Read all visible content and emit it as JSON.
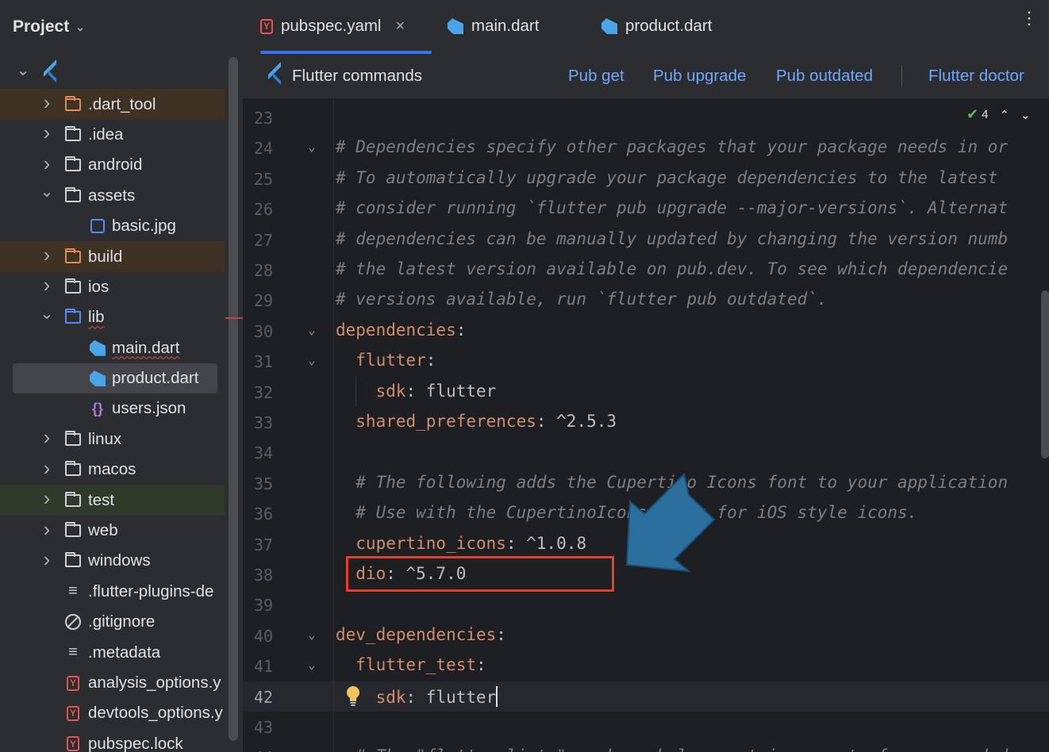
{
  "sidebar": {
    "title": "Project",
    "items": [
      {
        "label": "",
        "kind": "root",
        "arrow": "open",
        "icon": "flutter-icon"
      },
      {
        "label": ".dart_tool",
        "arrow": "closed",
        "icon": "folder-orange-icon",
        "hl": "excl"
      },
      {
        "label": ".idea",
        "arrow": "closed",
        "icon": "folder-settings-icon"
      },
      {
        "label": "android",
        "arrow": "closed",
        "icon": "folder-icon"
      },
      {
        "label": "assets",
        "arrow": "open",
        "icon": "folder-icon"
      },
      {
        "label": "basic.jpg",
        "icon": "image-file-icon",
        "depth": 2
      },
      {
        "label": "build",
        "arrow": "closed",
        "icon": "folder-orange-icon",
        "hl": "excl"
      },
      {
        "label": "ios",
        "arrow": "closed",
        "icon": "folder-icon"
      },
      {
        "label": "lib",
        "arrow": "open",
        "icon": "folder-blue-icon",
        "squiggle": true
      },
      {
        "label": "main.dart",
        "icon": "dart-file-icon",
        "depth": 2,
        "squiggle": true
      },
      {
        "label": "product.dart",
        "icon": "dart-file-icon",
        "depth": 2,
        "selected": true
      },
      {
        "label": "users.json",
        "icon": "json-file-icon",
        "depth": 2
      },
      {
        "label": "linux",
        "arrow": "closed",
        "icon": "folder-icon"
      },
      {
        "label": "macos",
        "arrow": "closed",
        "icon": "folder-icon"
      },
      {
        "label": "test",
        "arrow": "closed",
        "icon": "folder-test-icon",
        "hl": "test"
      },
      {
        "label": "web",
        "arrow": "closed",
        "icon": "folder-web-icon"
      },
      {
        "label": "windows",
        "arrow": "closed",
        "icon": "folder-icon"
      },
      {
        "label": ".flutter-plugins-de",
        "icon": "text-file-icon"
      },
      {
        "label": ".gitignore",
        "icon": "ignore-file-icon"
      },
      {
        "label": ".metadata",
        "icon": "text-file-icon"
      },
      {
        "label": "analysis_options.y",
        "icon": "yaml-file-icon"
      },
      {
        "label": "devtools_options.y",
        "icon": "yaml-file-icon"
      },
      {
        "label": "pubspec.lock",
        "icon": "yaml-file-icon"
      }
    ]
  },
  "tabs": [
    {
      "label": "pubspec.yaml",
      "icon": "yaml-file-icon",
      "active": true,
      "close": "×"
    },
    {
      "label": "main.dart",
      "icon": "dart-file-icon"
    },
    {
      "label": "product.dart",
      "icon": "dart-file-icon"
    }
  ],
  "toolbar": {
    "title": "Flutter commands",
    "links": [
      "Pub get",
      "Pub upgrade",
      "Pub outdated",
      "Flutter doctor"
    ]
  },
  "inspection": {
    "count": "4"
  },
  "editor": {
    "lines": [
      {
        "n": "23",
        "parts": []
      },
      {
        "n": "24",
        "fold": true,
        "parts": [
          {
            "t": "# Dependencies specify other packages that your package needs in or",
            "c": "comment"
          }
        ]
      },
      {
        "n": "25",
        "parts": [
          {
            "t": "# To automatically upgrade your package dependencies to the latest",
            "c": "comment"
          }
        ]
      },
      {
        "n": "26",
        "parts": [
          {
            "t": "# consider running `flutter pub upgrade --major-versions`. Alternat",
            "c": "comment"
          }
        ]
      },
      {
        "n": "27",
        "parts": [
          {
            "t": "# dependencies can be manually updated by changing the version numb",
            "c": "comment"
          }
        ]
      },
      {
        "n": "28",
        "parts": [
          {
            "t": "# the latest version available on pub.dev. To see which dependencie",
            "c": "comment"
          }
        ]
      },
      {
        "n": "29",
        "parts": [
          {
            "t": "# versions available, run `flutter pub outdated`.",
            "c": "comment"
          }
        ]
      },
      {
        "n": "30",
        "fold": true,
        "parts": [
          {
            "t": "dependencies",
            "c": "key"
          },
          {
            "t": ":",
            "c": "punct"
          }
        ]
      },
      {
        "n": "31",
        "fold": true,
        "parts": [
          {
            "t": "  flutter",
            "c": "key"
          },
          {
            "t": ":",
            "c": "punct"
          }
        ]
      },
      {
        "n": "32",
        "parts": [
          {
            "t": "    sdk",
            "c": "key"
          },
          {
            "t": ": flutter",
            "c": "val"
          }
        ]
      },
      {
        "n": "33",
        "parts": [
          {
            "t": "  shared_preferences",
            "c": "key"
          },
          {
            "t": ": ^2.5.3",
            "c": "val"
          }
        ]
      },
      {
        "n": "34",
        "parts": []
      },
      {
        "n": "35",
        "parts": [
          {
            "t": "  # The following adds the Cupertino Icons font to your application",
            "c": "comment"
          }
        ]
      },
      {
        "n": "36",
        "parts": [
          {
            "t": "  # Use with the CupertinoIcons class for iOS style icons.",
            "c": "comment"
          }
        ]
      },
      {
        "n": "37",
        "parts": [
          {
            "t": "  cupertino_icons",
            "c": "key"
          },
          {
            "t": ": ^1.0.8",
            "c": "val"
          }
        ]
      },
      {
        "n": "38",
        "parts": [
          {
            "t": "  dio",
            "c": "key"
          },
          {
            "t": ": ^5.7.0",
            "c": "val"
          }
        ]
      },
      {
        "n": "39",
        "parts": []
      },
      {
        "n": "40",
        "fold": true,
        "parts": [
          {
            "t": "dev_dependencies",
            "c": "key"
          },
          {
            "t": ":",
            "c": "punct"
          }
        ]
      },
      {
        "n": "41",
        "fold": true,
        "parts": [
          {
            "t": "  flutter_test",
            "c": "key"
          },
          {
            "t": ":",
            "c": "punct"
          }
        ]
      },
      {
        "n": "42",
        "current": true,
        "parts": [
          {
            "t": "    sdk",
            "c": "key"
          },
          {
            "t": ": flutter",
            "c": "val"
          }
        ]
      },
      {
        "n": "43",
        "parts": []
      },
      {
        "n": "44",
        "parts": [
          {
            "t": "  # The \"flutter_lints\" package below contains a set of recommended",
            "c": "comment"
          }
        ]
      }
    ]
  },
  "colors": {
    "accent": "#3574f0",
    "highlight_box": "#e53e30",
    "arrow": "#2a6f9e"
  }
}
